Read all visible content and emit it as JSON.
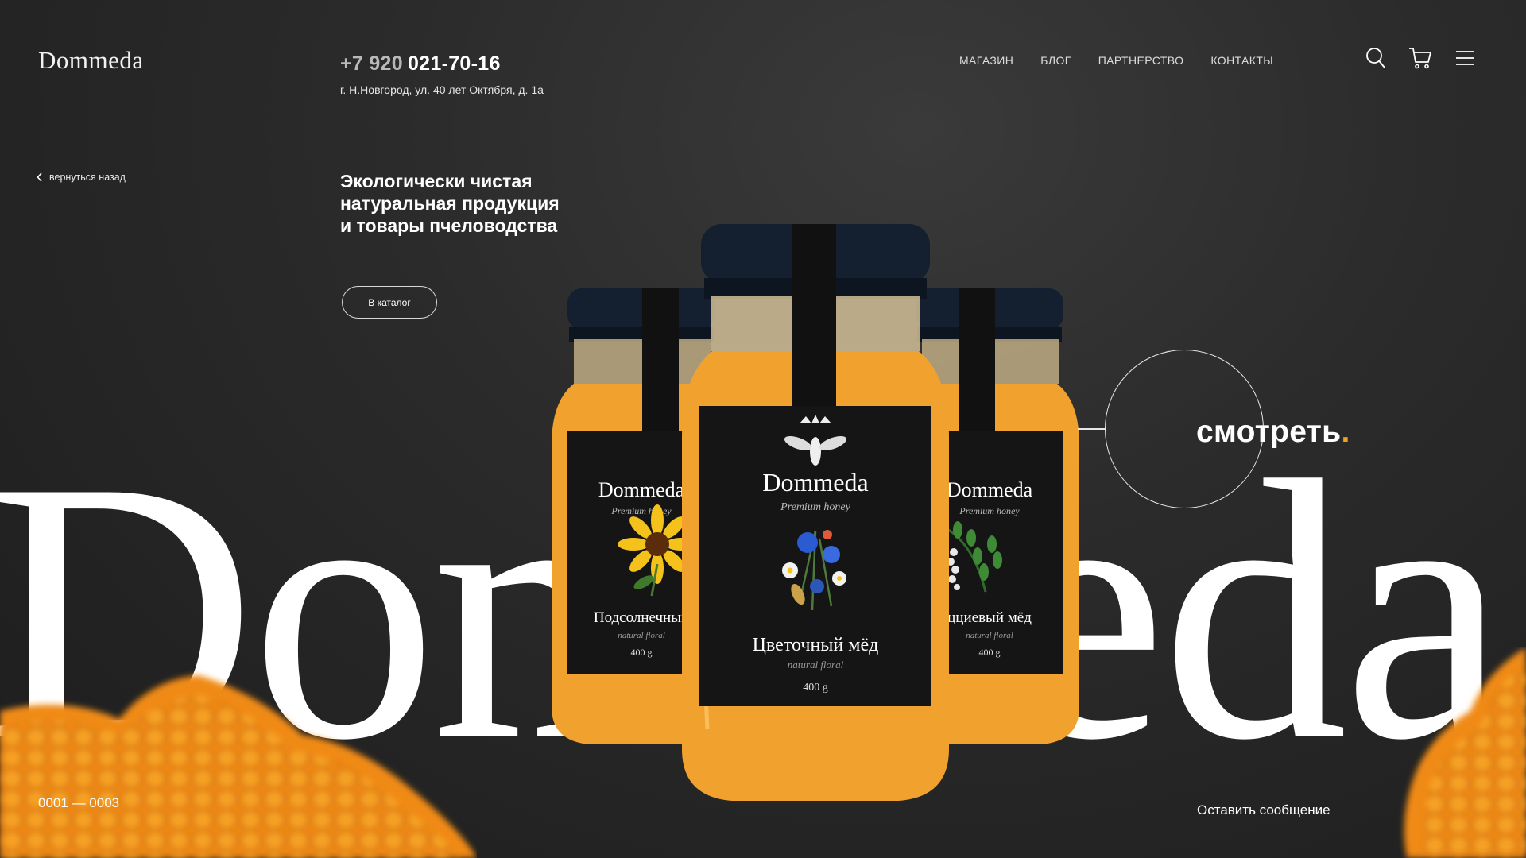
{
  "header": {
    "logo": "Dommeda",
    "phone_prefix": "+7 920",
    "phone_number": "021-70-16",
    "address": "г. Н.Новгород, ул. 40 лет Октября, д. 1а"
  },
  "nav": {
    "items": [
      {
        "label": "МАГАЗИН"
      },
      {
        "label": "БЛОГ"
      },
      {
        "label": "ПАРТНЕРСТВО"
      },
      {
        "label": "КОНТАКТЫ"
      }
    ]
  },
  "header_icons": [
    "search-icon",
    "cart-icon",
    "menu-icon"
  ],
  "back_link": "вернуться назад",
  "hero": {
    "headline_line1": "Экологически чистая",
    "headline_line2": "натуральная продукция",
    "headline_line3": "и товары пчеловодства",
    "catalog_button": "В каталог",
    "big_word": "Dommeda"
  },
  "look": {
    "label": "смотреть",
    "dot": "."
  },
  "products": {
    "left": {
      "brand": "Dommeda",
      "tagline": "Premium honey",
      "name": "Подсолнечный",
      "subtitle": "natural floral",
      "weight": "400 g"
    },
    "center": {
      "brand": "Dommeda",
      "tagline": "Premium honey",
      "name": "Цветочный мёд",
      "subtitle": "natural floral",
      "weight": "400 g"
    },
    "right": {
      "brand": "Dommeda",
      "tagline": "Premium honey",
      "name": "цциевый мёд",
      "subtitle": "natural floral",
      "weight": "400 g"
    }
  },
  "pager": {
    "current": "0001",
    "separator": "—",
    "total": "0003"
  },
  "footer": {
    "message_link": "Оставить сообщение"
  },
  "colors": {
    "background": "#262626",
    "honey": "#f0a12e",
    "accent_dot": "#f3a21f",
    "lid": "#14202f"
  }
}
